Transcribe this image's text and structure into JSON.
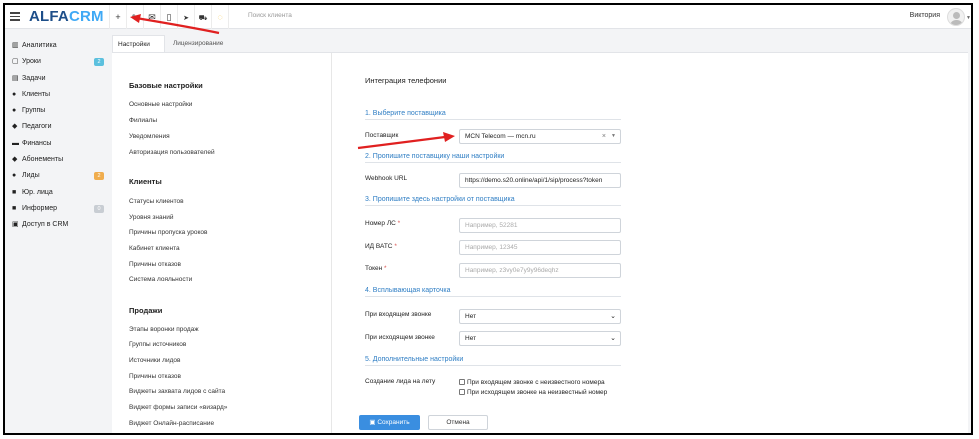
{
  "header": {
    "logo_part1": "ALFA",
    "logo_part2": "CRM",
    "tools": [
      {
        "icon": "plus-icon",
        "glyph": "+"
      },
      {
        "icon": "wrench-icon",
        "glyph": "🔧"
      },
      {
        "icon": "mail-icon",
        "glyph": "✉"
      },
      {
        "icon": "phone-icon",
        "glyph": "▯"
      },
      {
        "icon": "telegram-icon",
        "glyph": "➤"
      },
      {
        "icon": "cart-icon",
        "glyph": "🛒"
      },
      {
        "icon": "bell-icon",
        "glyph": "◌"
      }
    ],
    "search_placeholder": "Поиск клиента",
    "user_name": "Виктория"
  },
  "sidebar": {
    "items": [
      {
        "label": "Аналитика",
        "icon": "chart-icon",
        "glyph": "▥"
      },
      {
        "label": "Уроки",
        "icon": "calendar-icon",
        "glyph": "▢",
        "badge": "2",
        "badge_color": "#5bc0de"
      },
      {
        "label": "Задачи",
        "icon": "tasks-icon",
        "glyph": "▤"
      },
      {
        "label": "Клиенты",
        "icon": "user-icon",
        "glyph": "●"
      },
      {
        "label": "Группы",
        "icon": "users-icon",
        "glyph": "●"
      },
      {
        "label": "Педагоги",
        "icon": "graduation-icon",
        "glyph": "◆"
      },
      {
        "label": "Финансы",
        "icon": "money-icon",
        "glyph": "▬"
      },
      {
        "label": "Абонементы",
        "icon": "tag-icon",
        "glyph": "◆"
      },
      {
        "label": "Лиды",
        "icon": "leads-icon",
        "glyph": "●",
        "badge": "2",
        "badge_color": "#f0ad4e"
      },
      {
        "label": "Юр. лица",
        "icon": "briefcase-icon",
        "glyph": "■"
      },
      {
        "label": "Информер",
        "icon": "informer-icon",
        "glyph": "■",
        "badge": "0",
        "badge_color": "#c8cdd3"
      },
      {
        "label": "Доступ в CRM",
        "icon": "lock-icon",
        "glyph": "▣"
      }
    ]
  },
  "tabs": [
    {
      "label": "Настройки",
      "active": true
    },
    {
      "label": "Лицензирование",
      "active": false
    }
  ],
  "settings_menu": {
    "sections": [
      {
        "title": "Базовые настройки",
        "links": [
          "Основные настройки",
          "Филиалы",
          "Уведомления",
          "Авторизация пользователей"
        ]
      },
      {
        "title": "Клиенты",
        "links": [
          "Статусы клиентов",
          "Уровня знаний",
          "Причины пропуска уроков",
          "Кабинет клиента",
          "Причины отказов",
          "Система лояльности"
        ]
      },
      {
        "title": "Продажи",
        "links": [
          "Этапы воронки продаж",
          "Группы источников",
          "Источники лидов",
          "Причины отказов",
          "Виджеты захвата лидов с сайта",
          "Виджет формы записи «визард»",
          "Виджет Онлайн-расписание"
        ]
      }
    ]
  },
  "telephony": {
    "title": "Интеграция телефонии",
    "step1": "1. Выберите поставщика",
    "provider_label": "Поставщик",
    "provider_value": "MCN Telecom — mcn.ru",
    "step2": "2. Пропишите поставщику наши настройки",
    "webhook_label": "Webhook URL",
    "webhook_value": "https://demo.s20.online/api/1/sip/process?token",
    "step3": "3. Пропишите здесь настройки от поставщика",
    "account_label": "Номер ЛС",
    "account_placeholder": "Например, 52281",
    "vats_label": "ИД ВАТС",
    "vats_placeholder": "Например, 12345",
    "token_label": "Токен",
    "token_placeholder": "Например, z3vy0e7y9y96deqhz",
    "required_mark": "*",
    "step4": "4. Всплывающая карточка",
    "incoming_label": "При входящем звонке",
    "incoming_value": "Нет",
    "outgoing_label": "При исходящем звонке",
    "outgoing_value": "Нет",
    "step5": "5. Дополнительные настройки",
    "create_lead_label": "Создание лида на лету",
    "check_incoming": "При входящем звонке с неизвестного номера",
    "check_outgoing": "При исходящем звонке на неизвестный номер"
  },
  "actions": {
    "save": "Сохранить",
    "cancel": "Отмена"
  },
  "colors": {
    "accent": "#2f7ec4",
    "save_button": "#3a8ee0",
    "annotation_arrow": "#e02020"
  }
}
